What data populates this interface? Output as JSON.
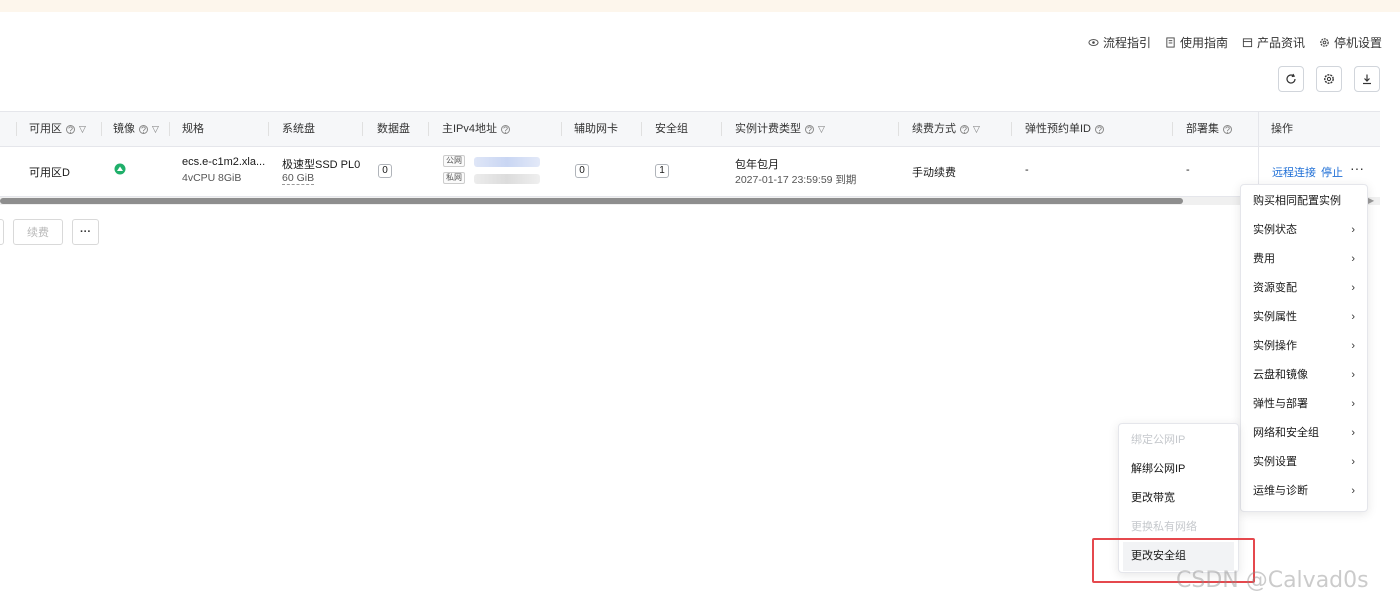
{
  "top_links": [
    {
      "label": "流程指引",
      "icon": "eye-icon"
    },
    {
      "label": "使用指南",
      "icon": "doc-icon"
    },
    {
      "label": "产品资讯",
      "icon": "calendar-icon"
    },
    {
      "label": "停机设置",
      "icon": "gear-icon"
    }
  ],
  "toolbar_icons": [
    "refresh-icon",
    "settings-icon",
    "download-icon"
  ],
  "table": {
    "headers": {
      "zone": "可用区",
      "image": "镜像",
      "spec": "规格",
      "system_disk": "系统盘",
      "data_disk": "数据盘",
      "ipv4": "主IPv4地址",
      "eni": "辅助网卡",
      "security_group": "安全组",
      "billing_type": "实例计费类型",
      "renew_mode": "续费方式",
      "elastic_reservation": "弹性预约单ID",
      "deployment_set": "部署集",
      "actions": "操作"
    },
    "row": {
      "zone": "可用区D",
      "spec_name": "ecs.e-c1m2.xla...",
      "spec_cpu": "4vCPU",
      "spec_mem": "8GiB",
      "system_disk_type": "极速型SSD PL0",
      "system_disk_size": "60 GiB",
      "data_disk_count": "0",
      "ip_public_tag": "公网",
      "ip_private_tag": "私网",
      "eni_count": "0",
      "security_group_count": "1",
      "billing_type": "包年包月",
      "expire_time": "2027-01-17 23:59:59 到期",
      "renew_mode": "手动续费",
      "elastic_reservation": "-",
      "deployment_set": "-",
      "action_remote": "远程连接",
      "action_stop": "停止",
      "action_more": "···"
    }
  },
  "bottom_buttons": {
    "renew": "续费",
    "more": "···"
  },
  "main_menu": [
    {
      "label": "购买相同配置实例",
      "has_sub": false
    },
    {
      "label": "实例状态",
      "has_sub": true
    },
    {
      "label": "费用",
      "has_sub": true
    },
    {
      "label": "资源变配",
      "has_sub": true
    },
    {
      "label": "实例属性",
      "has_sub": true
    },
    {
      "label": "实例操作",
      "has_sub": true
    },
    {
      "label": "云盘和镜像",
      "has_sub": true
    },
    {
      "label": "弹性与部署",
      "has_sub": true
    },
    {
      "label": "网络和安全组",
      "has_sub": true
    },
    {
      "label": "实例设置",
      "has_sub": true
    },
    {
      "label": "运维与诊断",
      "has_sub": true
    }
  ],
  "sub_menu": [
    {
      "label": "绑定公网IP",
      "disabled": true
    },
    {
      "label": "解绑公网IP",
      "disabled": false
    },
    {
      "label": "更改带宽",
      "disabled": false
    },
    {
      "label": "更换私有网络",
      "disabled": true
    },
    {
      "label": "更改安全组",
      "disabled": false
    }
  ],
  "chevron": "›",
  "watermark": "CSDN @Calvad0s",
  "colors": {
    "link": "#1f6fd6",
    "highlight_box": "#e5484d",
    "image_logo": "#1faf6a"
  }
}
